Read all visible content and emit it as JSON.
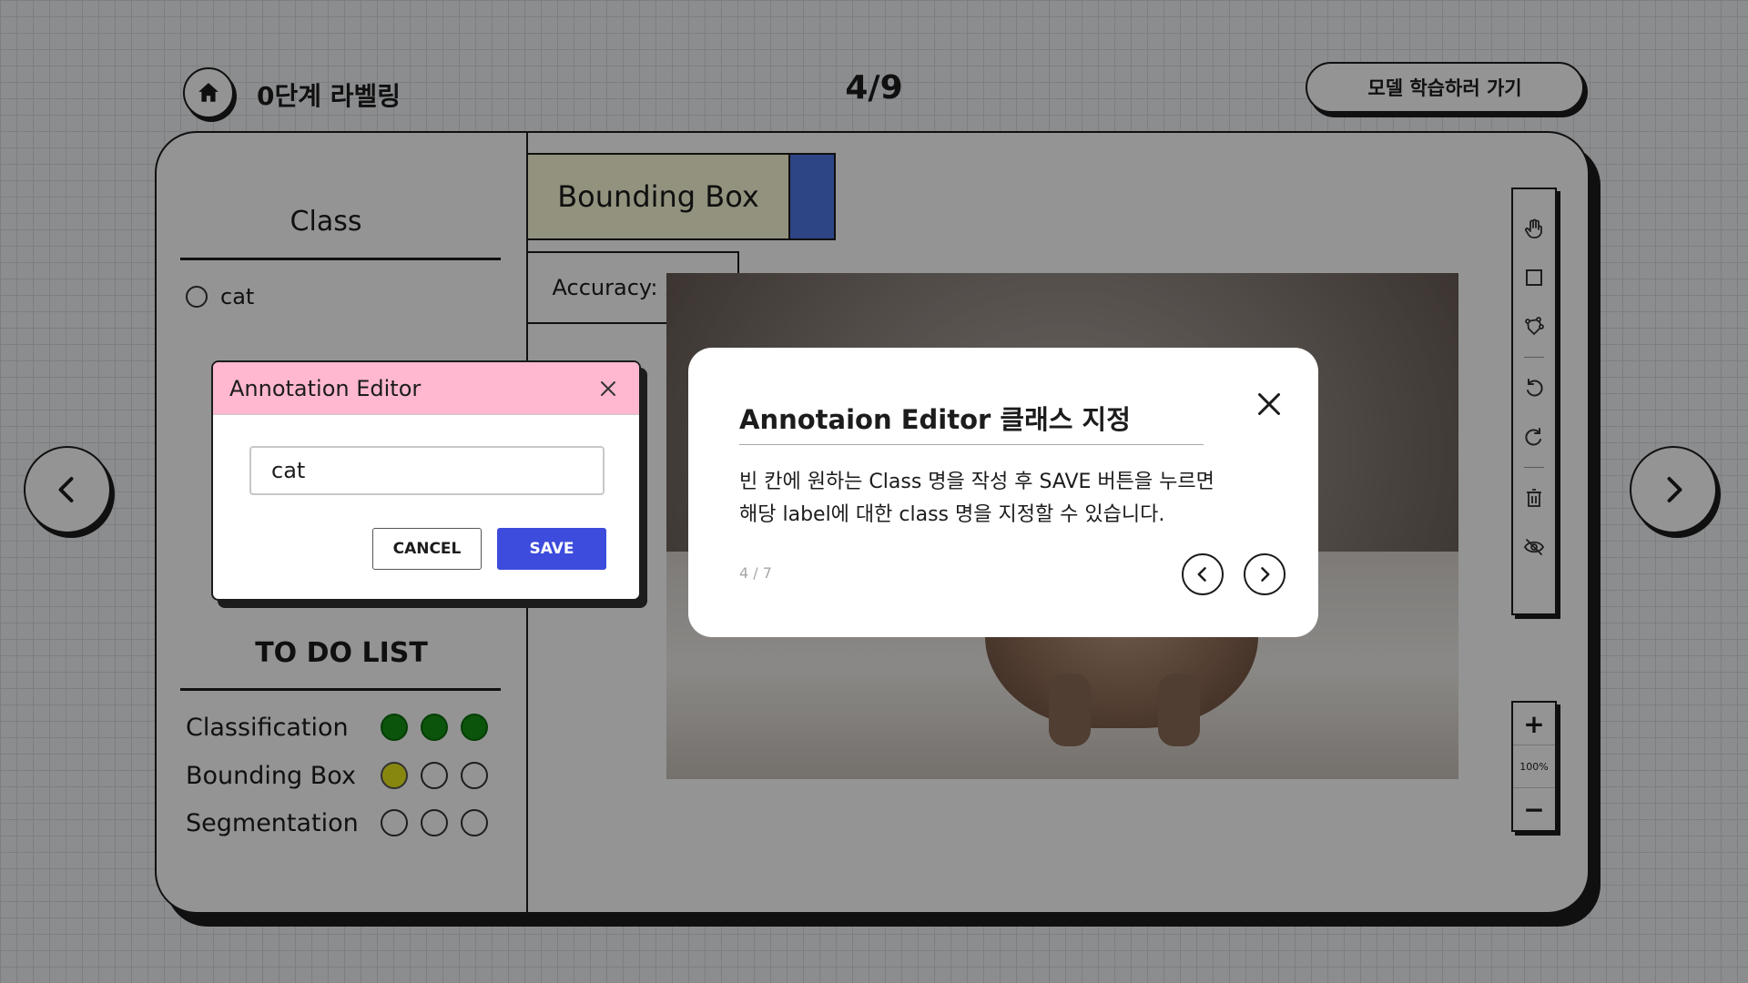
{
  "header": {
    "page_title": "0단계 라벨링",
    "counter": "4/9",
    "action_label": "모델 학습하러 가기"
  },
  "class_panel": {
    "title": "Class",
    "items": [
      {
        "label": "cat",
        "selected": false
      }
    ]
  },
  "mode": {
    "label": "Bounding Box",
    "color": "#4f76e6"
  },
  "accuracy": "Accuracy: 27%",
  "todo": {
    "title": "TO DO LIST",
    "rows": [
      {
        "label": "Classification",
        "completed": 3,
        "partial": 0,
        "total": 3
      },
      {
        "label": "Bounding Box",
        "completed": 0,
        "partial": 1,
        "total": 3
      },
      {
        "label": "Segmentation",
        "completed": 0,
        "partial": 0,
        "total": 3
      }
    ],
    "colors": {
      "done": "#139113",
      "partial": "#e8e81c"
    }
  },
  "tools": [
    "hand-icon",
    "rectangle-icon",
    "polygon-icon",
    "undo-icon",
    "redo-icon",
    "trash-icon",
    "hide-icon"
  ],
  "zoom": {
    "plus": "+",
    "level": "100%",
    "minus": "−"
  },
  "annotation_editor": {
    "title": "Annotation Editor",
    "input_value": "cat",
    "cancel_label": "CANCEL",
    "save_label": "SAVE",
    "header_color": "#ffb8cf",
    "save_color": "#3d4cdc"
  },
  "tutorial": {
    "title": "Annotaion Editor 클래스 지정",
    "line1": "빈 칸에 원하는 Class 명을 작성 후 SAVE 버튼을 누르면",
    "line2": "해당 label에 대한 class 명을 지정할 수 있습니다.",
    "step": "4 / 7"
  }
}
